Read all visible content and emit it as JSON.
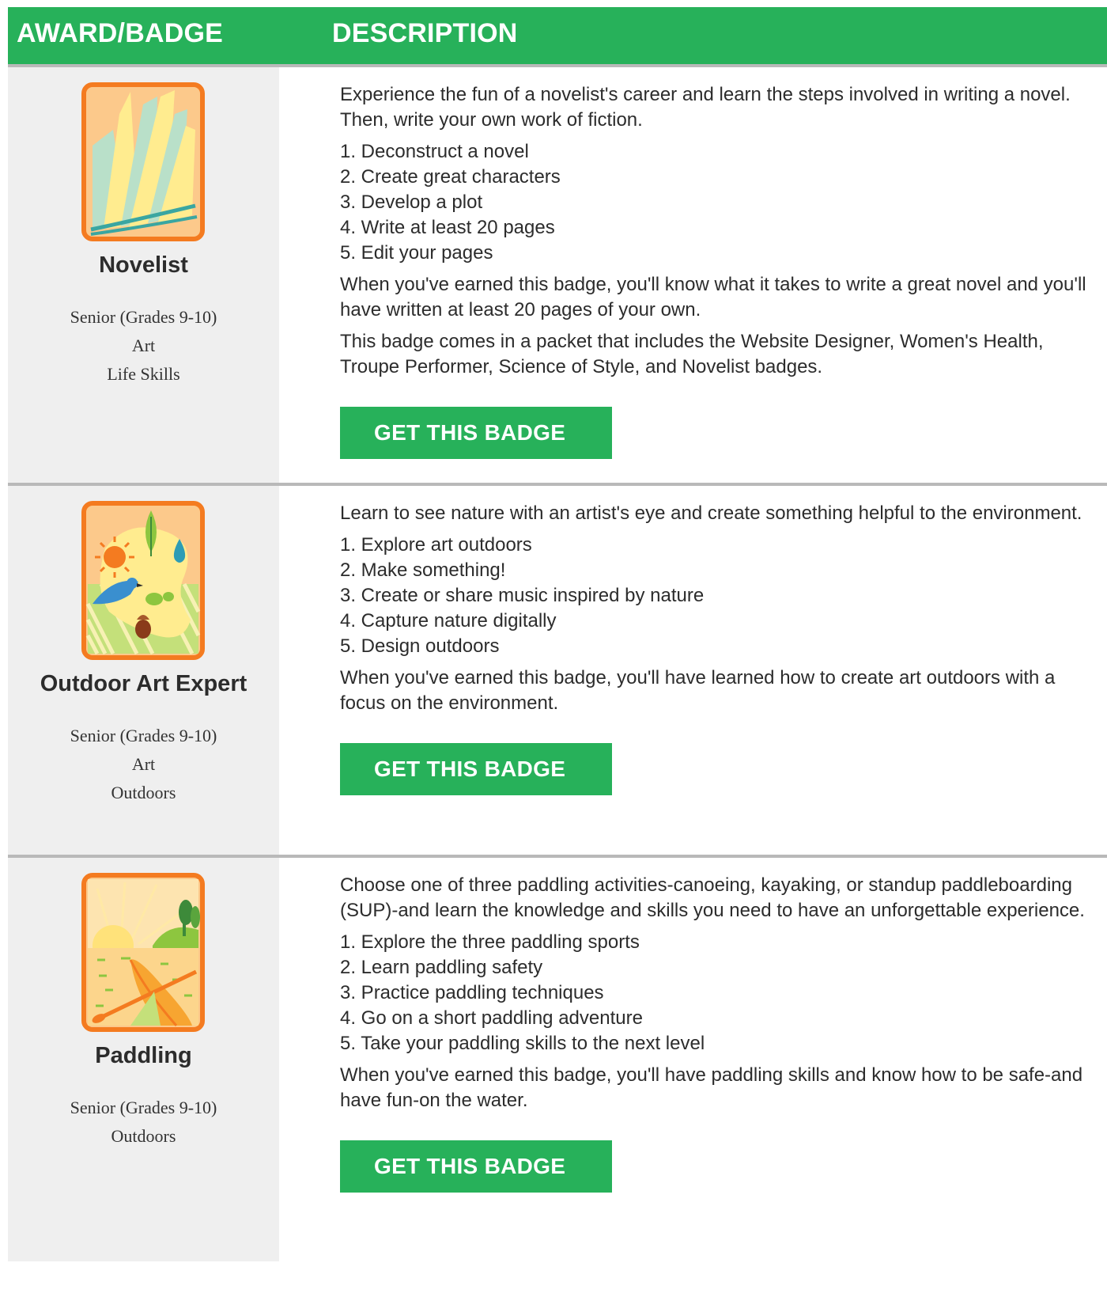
{
  "header": {
    "col_award": "AWARD/BADGE",
    "col_description": "DESCRIPTION"
  },
  "badges": [
    {
      "name": "Novelist",
      "meta": [
        "Senior (Grades 9-10)",
        "Art",
        "Life Skills"
      ],
      "intro": "Experience the fun of a novelist's career and learn the steps involved in writing a novel. Then, write your own work of fiction.",
      "steps": [
        "1. Deconstruct a novel",
        "2. Create great characters",
        "3. Develop a plot",
        "4. Write at least 20 pages",
        "5. Edit your pages"
      ],
      "outcome": "When you've earned this badge, you'll know what it takes to write a great novel and you'll have written at least 20 pages of your own.",
      "extra": "This badge comes in a packet that includes the Website Designer, Women's Health, Troupe Performer, Science of Style, and Novelist badges.",
      "button": "GET THIS BADGE",
      "icon": "open-book-badge-icon"
    },
    {
      "name": "Outdoor Art Expert",
      "meta": [
        "Senior (Grades 9-10)",
        "Art",
        "Outdoors"
      ],
      "intro": "Learn to see nature with an artist's eye and create something helpful to the environment.",
      "steps": [
        "1. Explore art outdoors",
        "2. Make something!",
        "3. Create or share music inspired by nature",
        "4. Capture nature digitally",
        "5. Design outdoors"
      ],
      "outcome": "When you've earned this badge, you'll have learned how to create art outdoors with a focus on the environment.",
      "button": "GET THIS BADGE",
      "icon": "nature-palette-badge-icon"
    },
    {
      "name": "Paddling",
      "meta": [
        "Senior (Grades 9-10)",
        "Outdoors"
      ],
      "intro": "Choose one of three paddling activities-canoeing, kayaking, or standup paddleboarding (SUP)-and learn the knowledge and skills you need to have an unforgettable experience.",
      "steps": [
        "1. Explore the three paddling sports",
        "2. Learn paddling safety",
        "3. Practice paddling techniques",
        "4. Go on a short paddling adventure",
        "5. Take your paddling skills to the next level"
      ],
      "outcome": "When you've earned this badge, you'll have paddling skills and know how to be safe-and have fun-on the water.",
      "button": "GET THIS BADGE",
      "icon": "kayak-sunset-badge-icon"
    }
  ],
  "colors": {
    "accent_green": "#27b15a",
    "badge_border_orange": "#f47b20",
    "left_column_bg": "#efefef"
  }
}
